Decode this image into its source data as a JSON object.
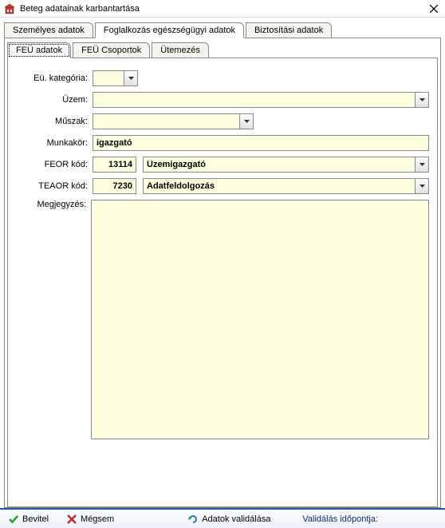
{
  "window": {
    "title": "Beteg adatainak karbantartása"
  },
  "main_tabs": {
    "tab1": "Személyes adatok",
    "tab2": "Foglalkozás egészségügyi adatok",
    "tab3": "Biztosítási adatok"
  },
  "sub_tabs": {
    "tab1": "FEÜ adatok",
    "tab2": "FEÜ Csoportok",
    "tab3": "Ütemezés"
  },
  "form": {
    "eu_kategoria": {
      "label": "Eü. kategória:",
      "value": ""
    },
    "uzem": {
      "label": "Üzem:",
      "value": ""
    },
    "muszak": {
      "label": "Műszak:",
      "value": ""
    },
    "munkakor": {
      "label": "Munkakör:",
      "value": "igazgató"
    },
    "feor": {
      "label": "FEOR kód:",
      "code": "13114",
      "desc": "Üzemigazgató"
    },
    "teaor": {
      "label": "TEAOR kód:",
      "code": "7230",
      "desc": "Adatfeldolgozás"
    },
    "megjegyzes": {
      "label": "Megjegyzés:",
      "value": ""
    }
  },
  "statusbar": {
    "bevitel": "Bevitel",
    "megsem": "Mégsem",
    "adatok_validalasa": "Adatok validálása",
    "validalas_idopontja": "Validálás időpontja:"
  }
}
